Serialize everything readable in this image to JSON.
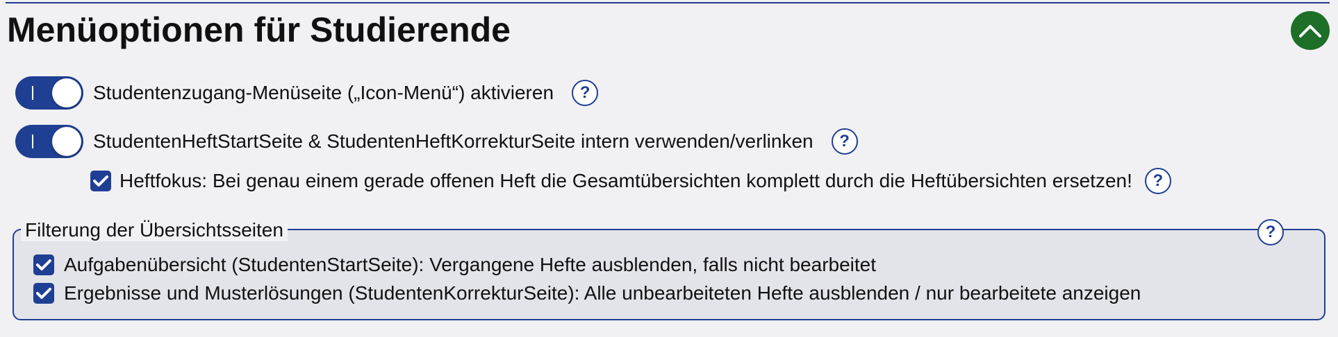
{
  "section": {
    "title": "Menüoptionen für Studierende"
  },
  "options": {
    "icon_menu": {
      "label": "Studentenzugang-Menüseite („Icon-Menü“) aktivieren",
      "enabled": true,
      "toggle_mark": "I",
      "help": "?"
    },
    "heft_pages": {
      "label": "StudentenHeftStartSeite & StudentenHeftKorrekturSeite intern verwenden/verlinken",
      "enabled": true,
      "toggle_mark": "I",
      "help": "?"
    },
    "heftfokus": {
      "label": "Heftfokus: Bei genau einem gerade offenen Heft die Gesamtübersichten komplett durch die Heftübersichten ersetzen!",
      "checked": true,
      "help": "?"
    }
  },
  "filter": {
    "legend": "Filterung der Übersichtsseiten",
    "help": "?",
    "items": [
      {
        "label": "Aufgabenübersicht (StudentenStartSeite): Vergangene Hefte ausblenden, falls nicht bearbeitet",
        "checked": true
      },
      {
        "label": "Ergebnisse und Musterlösungen (StudentenKorrekturSeite): Alle unbearbeiteten Hefte ausblenden / nur bearbeitete anzeigen",
        "checked": true
      }
    ]
  },
  "colors": {
    "accent": "#1f3f93",
    "collapse_button": "#1e6f28",
    "panel_background": "#f1f1f3",
    "fieldset_background": "#e3e3ea"
  },
  "icons": {
    "collapse": "chevron-up-icon",
    "help": "help-icon",
    "checkbox": "checkmark-icon"
  }
}
